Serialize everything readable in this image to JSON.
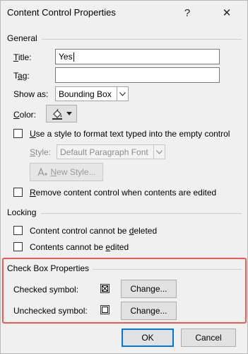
{
  "dialog": {
    "title": "Content Control Properties",
    "help_glyph": "?",
    "close_glyph": "✕"
  },
  "general": {
    "label": "General",
    "title_label_u": "T",
    "title_label_rest": "itle:",
    "title_value": "Yes",
    "tag_label_pre": "T",
    "tag_label_u": "a",
    "tag_label_rest": "g:",
    "tag_value": "",
    "show_as_label": "Show as:",
    "show_as_value": "Bounding Box",
    "color_label_u": "C",
    "color_label_rest": "olor:",
    "use_style_label_u": "U",
    "use_style_label_rest": "se a style to format text typed into the empty control",
    "use_style_checked": false,
    "style_label_u": "S",
    "style_label_rest": "tyle:",
    "style_value": "Default Paragraph Font",
    "new_style_label_u": "N",
    "new_style_label_rest": "ew Style...",
    "remove_label_u": "R",
    "remove_label_rest": "emove content control when contents are edited",
    "remove_checked": false
  },
  "locking": {
    "label": "Locking",
    "cannot_delete_pre": "Content control cannot be ",
    "cannot_delete_u": "d",
    "cannot_delete_rest": "eleted",
    "cannot_delete_checked": false,
    "cannot_edit_pre": "Contents cannot be ",
    "cannot_edit_u": "e",
    "cannot_edit_rest": "dited",
    "cannot_edit_checked": false
  },
  "checkbox_props": {
    "label": "Check Box Properties",
    "checked_symbol_label": "Checked symbol:",
    "checked_symbol_glyph": "☒",
    "unchecked_symbol_label": "Unchecked symbol:",
    "unchecked_symbol_glyph": "☐",
    "change_label_pre": "Chan",
    "change_label_u": "g",
    "change_label_rest": "e...",
    "change2_label_pre": "Chan",
    "change2_label_u": "g",
    "change2_label_rest": "e...",
    "highlight_color": "#ef5a4e"
  },
  "footer": {
    "ok_label": "OK",
    "cancel_label": "Cancel"
  },
  "icons": {
    "dropdown": "chevron-down-icon",
    "color": "paint-bucket-icon",
    "new_style": "new-style-icon"
  }
}
